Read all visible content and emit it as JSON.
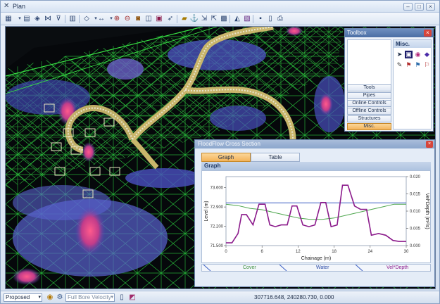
{
  "window": {
    "title": "Plan"
  },
  "toolbox": {
    "title": "Toolbox",
    "active_panel": "Misc.",
    "categories": [
      "Tools",
      "Pipes",
      "Online Controls",
      "Offline Controls",
      "Structures",
      "Misc."
    ],
    "active_category_index": 5
  },
  "cross_section": {
    "title": "FloodFlow Cross Section",
    "tabs": [
      "Graph",
      "Table"
    ],
    "active_tab": "Graph",
    "panel_caption": "Graph",
    "legend": [
      "Cover",
      "Water",
      "Vel*Depth"
    ],
    "chart_data": {
      "type": "line",
      "xlabel": "Chainage (m)",
      "ylabel": "Level (m)",
      "y2label": "Vel*Depth (m²/s)",
      "xlim": [
        0,
        30
      ],
      "ylim": [
        71.5,
        74.0
      ],
      "y2lim": [
        0.0,
        0.02
      ],
      "x_ticks": [
        "0",
        "6",
        "12",
        "18",
        "24",
        "30"
      ],
      "y_ticks": [
        "71.500",
        "72.200",
        "72.900",
        "73.600"
      ],
      "y2_ticks": [
        "0.000",
        "0.005",
        "0.010",
        "0.015",
        "0.020"
      ],
      "series": [
        {
          "name": "Cover",
          "color": "#4da64d",
          "x": [
            0,
            2,
            4,
            6,
            8,
            10,
            12,
            14,
            16,
            18,
            20,
            22,
            24,
            26,
            28,
            30
          ],
          "y": [
            73.0,
            72.95,
            72.85,
            72.8,
            72.7,
            72.6,
            72.5,
            72.45,
            72.45,
            72.5,
            72.6,
            72.7,
            72.8,
            72.9,
            73.0,
            73.0
          ]
        },
        {
          "name": "Water",
          "color": "#3b5fc4",
          "x": [
            0,
            30
          ],
          "y": [
            73.05,
            73.05
          ]
        },
        {
          "name": "Vel*Depth",
          "color": "#8b1a8b",
          "axis": "y2",
          "x": [
            0,
            1,
            2,
            2.6,
            3.4,
            4.5,
            5.5,
            6.5,
            7.3,
            8.2,
            9.2,
            10.2,
            11.0,
            11.8,
            12.8,
            13.8,
            14.8,
            15.8,
            16.6,
            17.5,
            18.5,
            19.4,
            20.3,
            21.4,
            22.4,
            23.4,
            24.2,
            25.4,
            26.6,
            27.8,
            28.8,
            30
          ],
          "y": [
            0.0008,
            0.0008,
            0.0035,
            0.009,
            0.009,
            0.006,
            0.012,
            0.012,
            0.006,
            0.0055,
            0.006,
            0.006,
            0.0115,
            0.0115,
            0.006,
            0.0055,
            0.006,
            0.0125,
            0.0125,
            0.0055,
            0.006,
            0.0175,
            0.0175,
            0.0115,
            0.0105,
            0.0105,
            0.003,
            0.0035,
            0.003,
            0.0015,
            0.0012,
            0.0012
          ]
        }
      ]
    }
  },
  "statusbar": {
    "scenario": "Proposed",
    "display_mode": "Full Bore Velocity",
    "coordinates": "307716.648, 240280.730, 0.000"
  }
}
